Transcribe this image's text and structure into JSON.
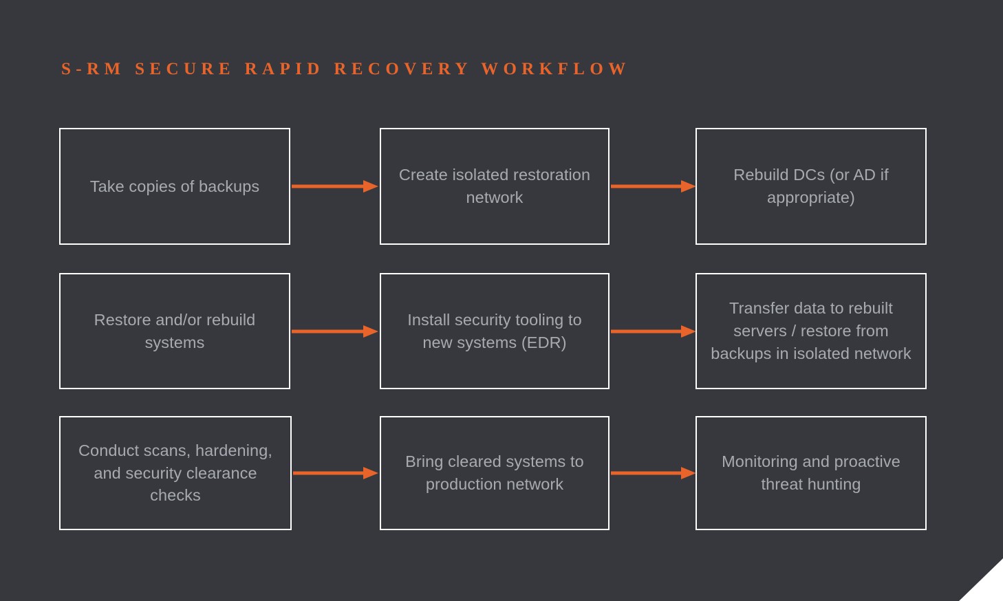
{
  "slide": {
    "title": "S-RM SECURE RAPID RECOVERY WORKFLOW",
    "background_color": "#36383d",
    "accent_color": "#e8642b",
    "box_border_color": "#ffffff",
    "box_text_color": "#a7aab1",
    "corner_accent_color": "#ffffff"
  },
  "workflow": {
    "rows": [
      {
        "row_index": 1,
        "boxes": [
          {
            "id": "take-copies-of-backups",
            "label": "Take copies of backups"
          },
          {
            "id": "create-isolated-restoration-network",
            "label": "Create isolated restoration network"
          },
          {
            "id": "rebuild-dcs",
            "label": "Rebuild DCs (or AD if appropriate)"
          }
        ],
        "arrows": [
          {
            "id": "arrow-row1-1",
            "from": "take-copies-of-backups",
            "to": "create-isolated-restoration-network",
            "direction": "right"
          },
          {
            "id": "arrow-row1-2",
            "from": "create-isolated-restoration-network",
            "to": "rebuild-dcs",
            "direction": "right"
          }
        ]
      },
      {
        "row_index": 2,
        "boxes": [
          {
            "id": "restore-rebuild-systems",
            "label": "Restore and/or rebuild systems"
          },
          {
            "id": "install-security-tooling",
            "label": "Install security tooling to new systems (EDR)"
          },
          {
            "id": "transfer-data-to-rebuilt-servers",
            "label": "Transfer data to rebuilt servers / restore from backups in isolated network"
          }
        ],
        "arrows": [
          {
            "id": "arrow-row2-1",
            "from": "restore-rebuild-systems",
            "to": "install-security-tooling",
            "direction": "right"
          },
          {
            "id": "arrow-row2-2",
            "from": "install-security-tooling",
            "to": "transfer-data-to-rebuilt-servers",
            "direction": "right"
          }
        ]
      },
      {
        "row_index": 3,
        "boxes": [
          {
            "id": "conduct-scans-hardening",
            "label": "Conduct scans, hardening, and security clearance checks"
          },
          {
            "id": "bring-cleared-systems-to-production",
            "label": "Bring cleared systems to production network"
          },
          {
            "id": "monitoring-threat-hunting",
            "label": "Monitoring and proactive threat hunting"
          }
        ],
        "arrows": [
          {
            "id": "arrow-row3-1",
            "from": "conduct-scans-hardening",
            "to": "bring-cleared-systems-to-production",
            "direction": "right"
          },
          {
            "id": "arrow-row3-2",
            "from": "bring-cleared-systems-to-production",
            "to": "monitoring-threat-hunting",
            "direction": "right"
          }
        ]
      }
    ]
  }
}
